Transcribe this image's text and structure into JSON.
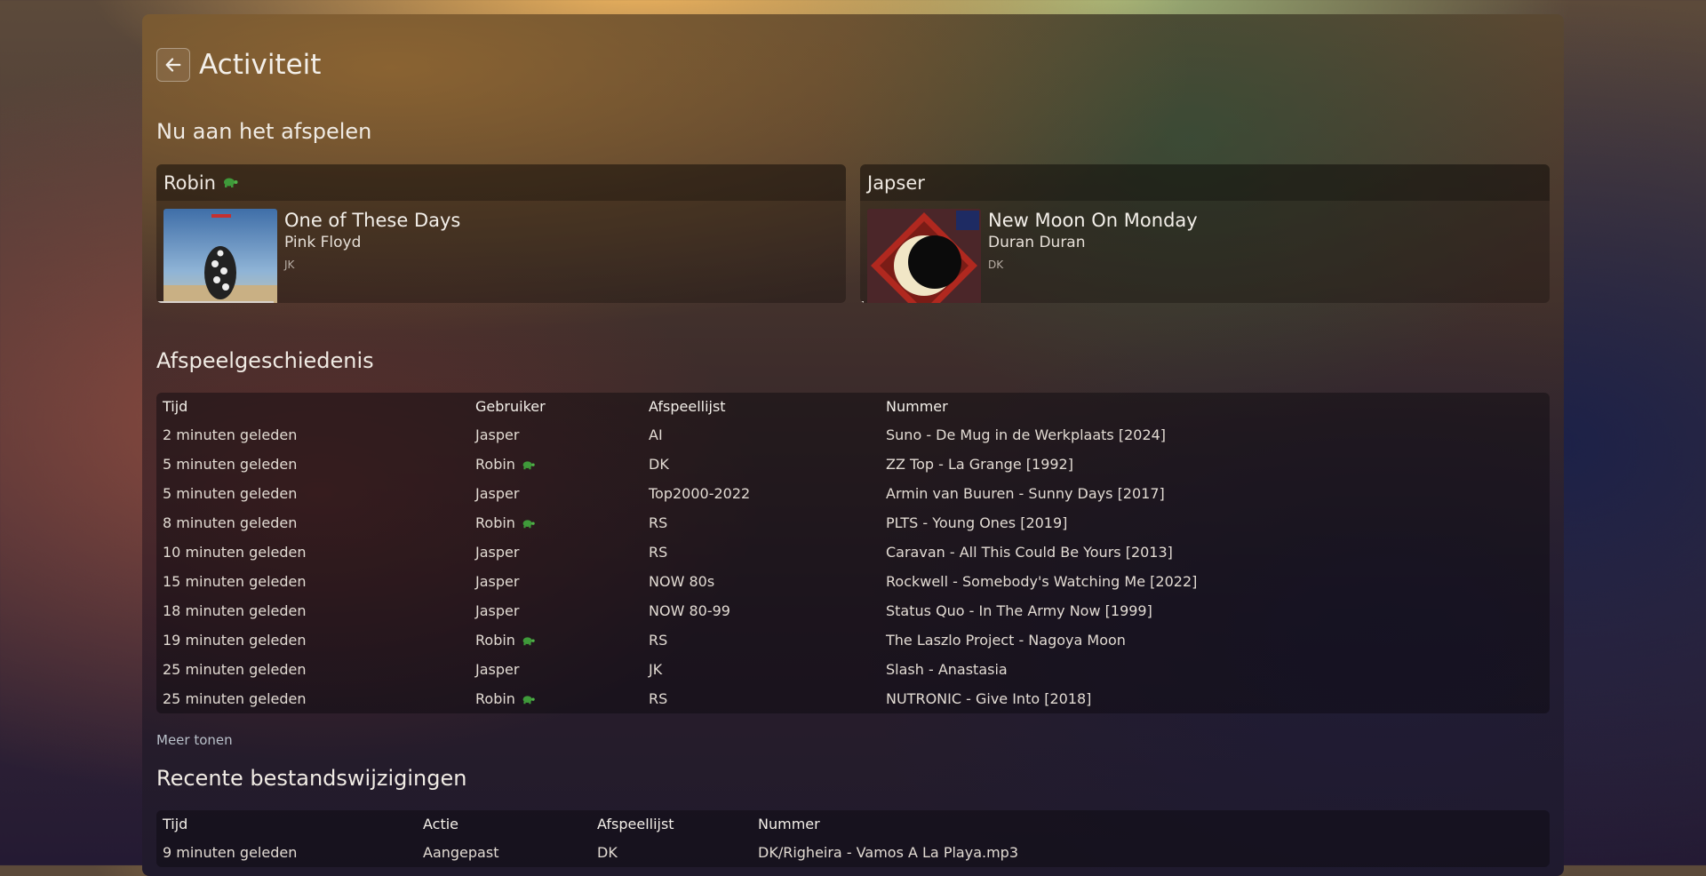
{
  "header": {
    "title": "Activiteit"
  },
  "now_playing": {
    "title": "Nu aan het afspelen",
    "cards": [
      {
        "user": "Robin",
        "turtle": true,
        "track": "One of These Days",
        "artist": "Pink Floyd",
        "playlist": "JK",
        "progress_percent": 17
      },
      {
        "user": "Japser",
        "turtle": false,
        "track": "New Moon On Monday",
        "artist": "Duran Duran",
        "playlist": "DK",
        "progress_percent": 0.5
      }
    ]
  },
  "history": {
    "title": "Afspeelgeschiedenis",
    "columns": [
      "Tijd",
      "Gebruiker",
      "Afspeellijst",
      "Nummer"
    ],
    "rows": [
      {
        "time": "2 minuten geleden",
        "user": "Jasper",
        "turtle": false,
        "playlist": "AI",
        "track": "Suno - De Mug in de Werkplaats [2024]"
      },
      {
        "time": "5 minuten geleden",
        "user": "Robin",
        "turtle": true,
        "playlist": "DK",
        "track": "ZZ Top - La Grange [1992]"
      },
      {
        "time": "5 minuten geleden",
        "user": "Jasper",
        "turtle": false,
        "playlist": "Top2000-2022",
        "track": "Armin van Buuren - Sunny Days [2017]"
      },
      {
        "time": "8 minuten geleden",
        "user": "Robin",
        "turtle": true,
        "playlist": "RS",
        "track": "PLTS - Young Ones [2019]"
      },
      {
        "time": "10 minuten geleden",
        "user": "Jasper",
        "turtle": false,
        "playlist": "RS",
        "track": "Caravan - All This Could Be Yours [2013]"
      },
      {
        "time": "15 minuten geleden",
        "user": "Jasper",
        "turtle": false,
        "playlist": "NOW 80s",
        "track": "Rockwell - Somebody's Watching Me [2022]"
      },
      {
        "time": "18 minuten geleden",
        "user": "Jasper",
        "turtle": false,
        "playlist": "NOW 80-99",
        "track": "Status Quo - In The Army Now [1999]"
      },
      {
        "time": "19 minuten geleden",
        "user": "Robin",
        "turtle": true,
        "playlist": "RS",
        "track": "The Laszlo Project - Nagoya Moon"
      },
      {
        "time": "25 minuten geleden",
        "user": "Jasper",
        "turtle": false,
        "playlist": "JK",
        "track": "Slash - Anastasia"
      },
      {
        "time": "25 minuten geleden",
        "user": "Robin",
        "turtle": true,
        "playlist": "RS",
        "track": "NUTRONIC - Give Into [2018]"
      }
    ],
    "more_label": "Meer tonen"
  },
  "changes": {
    "title": "Recente bestandswijzigingen",
    "columns": [
      "Tijd",
      "Actie",
      "Afspeellijst",
      "Nummer"
    ],
    "rows": [
      {
        "time": "9 minuten geleden",
        "action": "Aangepast",
        "playlist": "DK",
        "track": "DK/Righeira - Vamos A La Playa.mp3"
      }
    ]
  },
  "icons": {
    "back": "arrow-left-icon",
    "turtle": "turtle-icon"
  },
  "colors": {
    "turtle": "#3f9a3a",
    "progress": "#d8d2cc"
  }
}
